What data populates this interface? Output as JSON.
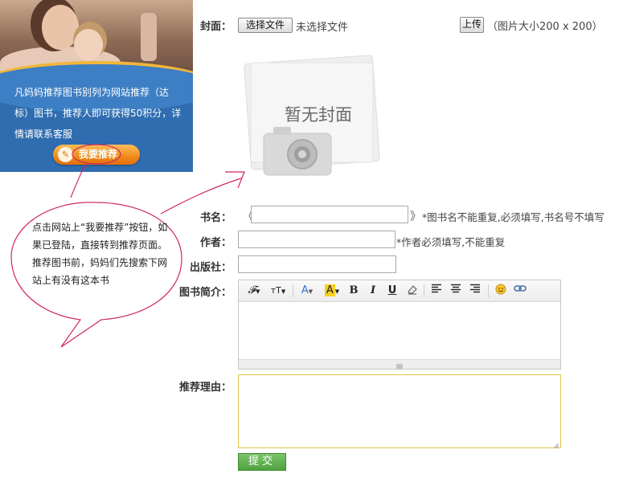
{
  "promo": {
    "text": "凡妈妈推荐图书别列为网站推荐（达标）图书，推荐人即可获得50积分，详情请联系客服",
    "button_label": "我要推荐",
    "button_icon": "pencil-note-icon"
  },
  "callout": {
    "text": "点击网站上“我要推荐”按钮，如果已登陆，直接转到推荐页面。推荐图书前，妈妈们先搜索下网站上有没有这本书"
  },
  "cover": {
    "label": "封面：",
    "choose_button": "选择文件",
    "no_file": "未选择文件",
    "upload_button": "上传",
    "size_hint": "（图片大小200 x 200）",
    "placeholder_text": "暂无封面"
  },
  "book_name": {
    "label": "书名：",
    "left_bracket": "《",
    "right_bracket": "》",
    "value": "",
    "hint": "*图书名不能重复,必须填写,书名号不填写"
  },
  "author": {
    "label": "作者：",
    "value": "",
    "hint": "*作者必须填写,不能重复"
  },
  "publisher": {
    "label": "出版社：",
    "value": ""
  },
  "intro": {
    "label": "图书简介：",
    "toolbar": {
      "font": "𝓕",
      "font_size": "тT",
      "font_color": "A",
      "highlight": "A",
      "bold": "B",
      "italic": "I",
      "underline": "U"
    },
    "value": ""
  },
  "reason": {
    "label": "推荐理由：",
    "value": ""
  },
  "submit_label": "提交",
  "colors": {
    "promo_blue": "#2f6db0",
    "promo_button": "#f08a1a",
    "callout_stroke": "#d0285a",
    "submit_green": "#5aa94a",
    "reason_border": "#e0c54a"
  }
}
